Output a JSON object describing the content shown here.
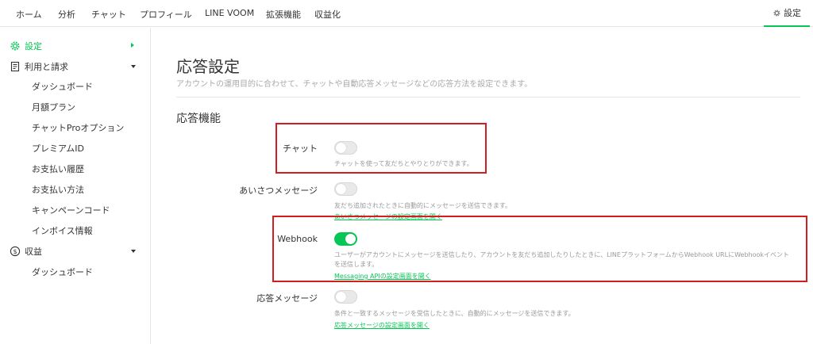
{
  "topnav": {
    "tabs": [
      "ホーム",
      "分析",
      "チャット",
      "プロフィール",
      "LINE VOOM",
      "拡張機能",
      "収益化"
    ],
    "settings_label": "設定"
  },
  "sidebar": {
    "settings": "設定",
    "billing": "利用と請求",
    "billing_items": [
      "ダッシュボード",
      "月額プラン",
      "チャットProオプション",
      "プレミアムID",
      "お支払い履歴",
      "お支払い方法",
      "キャンペーンコード",
      "インボイス情報"
    ],
    "revenue": "収益",
    "revenue_items": [
      "ダッシュボード"
    ]
  },
  "main": {
    "title": "応答設定",
    "subtitle": "アカウントの運用目的に合わせて、チャットや自動応答メッセージなどの応答方法を設定できます。",
    "section": "応答機能",
    "rows": [
      {
        "label": "チャット",
        "on": false,
        "desc": "チャットを使って友だちとやりとりができます。",
        "desc2": "",
        "link": ""
      },
      {
        "label": "あいさつメッセージ",
        "on": false,
        "desc": "友だち追加されたときに自動的にメッセージを送信できます。",
        "desc2": "",
        "link": "あいさつメッセージの設定画面を開く"
      },
      {
        "label": "Webhook",
        "on": true,
        "desc": "ユーザーがアカウントにメッセージを送信したり、アカウントを友だち追加したりしたときに、LINEプラットフォームからWebhook URLにWebhookイベント",
        "desc2": "を送信します。",
        "link": "Messaging APIの設定画面を開く"
      },
      {
        "label": "応答メッセージ",
        "on": false,
        "desc": "条件と一致するメッセージを受信したときに、自動的にメッセージを送信できます。",
        "desc2": "",
        "link": "応答メッセージの設定画面を開く"
      }
    ]
  },
  "colors": {
    "accent": "#06c755",
    "highlight_box": "#d21e1e"
  }
}
